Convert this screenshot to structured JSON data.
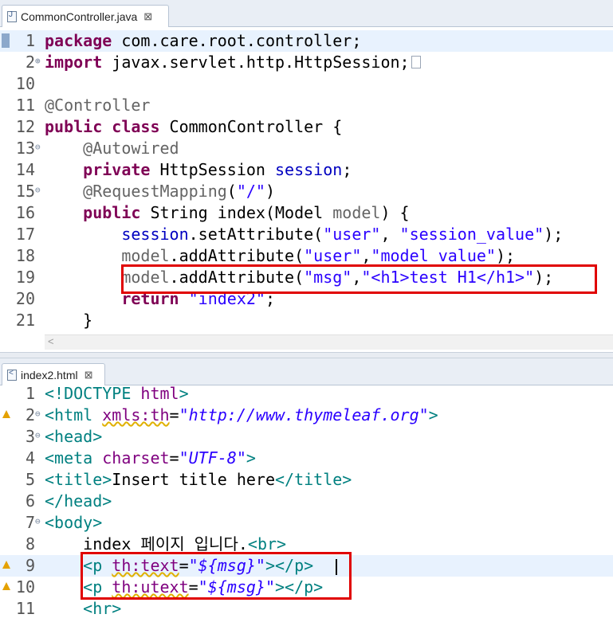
{
  "editor1": {
    "tab_label": "CommonController.java",
    "close_glyph": "⊠",
    "lines": [
      {
        "num": "1"
      },
      {
        "num": "2"
      },
      {
        "num": "10"
      },
      {
        "num": "11"
      },
      {
        "num": "12"
      },
      {
        "num": "13"
      },
      {
        "num": "14"
      },
      {
        "num": "15"
      },
      {
        "num": "16"
      },
      {
        "num": "17"
      },
      {
        "num": "18"
      },
      {
        "num": "19"
      },
      {
        "num": "20"
      },
      {
        "num": "21"
      }
    ],
    "code": {
      "l1_kw": "package",
      "l1_rest": " com.care.root.controller;",
      "l2_kw": "import",
      "l2_rest": " javax.servlet.http.HttpSession;",
      "l11_ann": "@Controller",
      "l12_kw1": "public",
      "l12_kw2": "class",
      "l12_rest": " CommonController {",
      "l13_ann": "@Autowired",
      "l14_kw": "private",
      "l14_type": " HttpSession ",
      "l14_fld": "session",
      "l14_end": ";",
      "l15_ann": "@RequestMapping",
      "l15_open": "(",
      "l15_str": "\"/\"",
      "l15_close": ")",
      "l16_kw": "public",
      "l16_rest": " String index(Model ",
      "l16_param": "model",
      "l16_end": ") {",
      "l17_obj": "session",
      "l17_call": ".setAttribute(",
      "l17_s1": "\"user\"",
      "l17_comma": ", ",
      "l17_s2": "\"session_value\"",
      "l17_end": ");",
      "l18_obj": "model",
      "l18_call": ".addAttribute(",
      "l18_s1": "\"user\"",
      "l18_comma": ",",
      "l18_s2": "\"model value\"",
      "l18_end": ");",
      "l19_obj": "model",
      "l19_call": ".addAttribute(",
      "l19_s1": "\"msg\"",
      "l19_comma": ",",
      "l19_s2": "\"<h1>test H1</h1>\"",
      "l19_end": ");",
      "l20_kw": "return",
      "l20_sp": " ",
      "l20_str": "\"index2\"",
      "l20_end": ";",
      "l21": "}"
    }
  },
  "editor2": {
    "tab_label": "index2.html",
    "close_glyph": "⊠",
    "lines": [
      {
        "num": "1"
      },
      {
        "num": "2"
      },
      {
        "num": "3"
      },
      {
        "num": "4"
      },
      {
        "num": "5"
      },
      {
        "num": "6"
      },
      {
        "num": "7"
      },
      {
        "num": "8"
      },
      {
        "num": "9"
      },
      {
        "num": "10"
      },
      {
        "num": "11"
      }
    ],
    "code": {
      "l1_a": "<!DOCTYPE",
      "l1_b": " html",
      "l1_c": ">",
      "l2_open": "<html ",
      "l2_attr": "xmls:th",
      "l2_eq": "=",
      "l2_val": "\"http://www.thymeleaf.org\"",
      "l2_close": ">",
      "l3": "<head>",
      "l4_open": "<meta ",
      "l4_attr": "charset",
      "l4_eq": "=",
      "l4_val": "\"UTF-8\"",
      "l4_close": ">",
      "l5_open": "<title>",
      "l5_text": "Insert title here",
      "l5_close": "</title>",
      "l6": "</head>",
      "l7": "<body>",
      "l8_text": "index 페이지 입니다.",
      "l8_tag": "<br>",
      "l9_open": "<p ",
      "l9_attr": "th:text",
      "l9_eq": "=",
      "l9_val": "\"${msg}\"",
      "l9_gt": ">",
      "l9_close": "</p>",
      "l10_open": "<p ",
      "l10_attr": "th:utext",
      "l10_eq": "=",
      "l10_val": "\"${msg}\"",
      "l10_gt": ">",
      "l10_close": "</p>",
      "l11": "<hr>"
    }
  },
  "colors": {
    "keyword": "#7f0055",
    "annotation": "#646464",
    "field": "#0000c0",
    "string": "#2a00ff",
    "html_tag": "#008080",
    "html_attr": "#7f007f",
    "highlight_box": "#e00000",
    "current_line": "#e8f2fe"
  },
  "icons": {
    "file": "java-file-icon",
    "html_file": "html-file-icon",
    "close": "close-icon",
    "warning": "warning-icon",
    "fold_expand": "fold-expand-icon",
    "fold_collapse": "fold-collapse-icon",
    "bookmark": "change-marker-icon",
    "scroll_left": "scroll-left-icon"
  }
}
